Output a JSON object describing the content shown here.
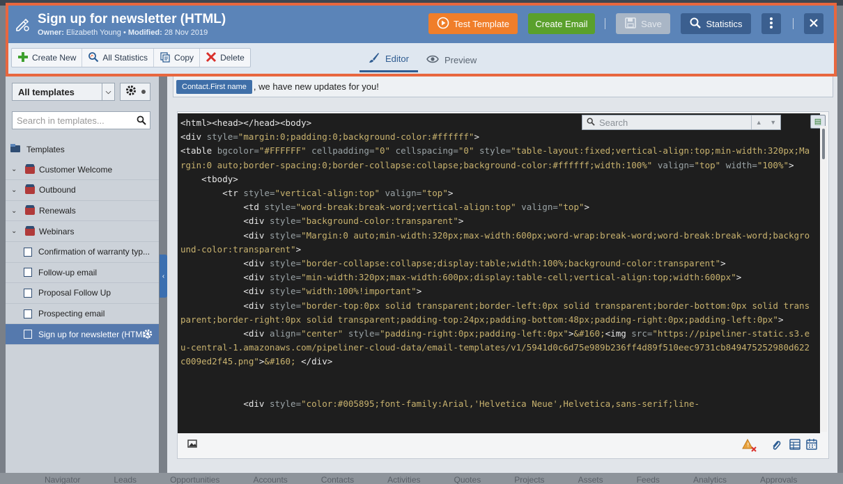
{
  "header": {
    "title": "Sign up for newsletter (HTML)",
    "owner_label": "Owner:",
    "owner": "Elizabeth Young",
    "modified_label": "Modified:",
    "modified": "28 Nov 2019",
    "test_label": "Test Template",
    "create_label": "Create Email",
    "save_label": "Save",
    "stats_label": "Statistics"
  },
  "toolbar": {
    "create_new": "Create New",
    "all_statistics": "All Statistics",
    "copy": "Copy",
    "delete": "Delete"
  },
  "tabs": {
    "editor": "Editor",
    "preview": "Preview"
  },
  "sidebar": {
    "dropdown": "All templates",
    "search_placeholder": "Search in templates...",
    "root": "Templates",
    "folders": [
      "Customer Welcome",
      "Outbound",
      "Renewals",
      "Webinars"
    ],
    "items": [
      "Confirmation of warranty typ...",
      "Follow-up email",
      "Proposal Follow Up",
      "Prospecting email",
      "Sign up for newsletter (HTML)"
    ]
  },
  "subject": {
    "chip": "Contact.First name",
    "text": ", we have new updates for you!"
  },
  "code_search": {
    "placeholder": "Search"
  },
  "background_nav": [
    "Navigator",
    "Leads",
    "Opportunities",
    "Accounts",
    "Contacts",
    "Activities",
    "Quotes",
    "Projects",
    "Assets",
    "Feeds",
    "Analytics",
    "Approvals"
  ],
  "colors": {
    "orange_frame": "#e8673f",
    "title_bar": "#5b84b8",
    "test_button": "#f07e2a",
    "create_button": "#5aa02c",
    "selected_row": "#5579ad"
  }
}
